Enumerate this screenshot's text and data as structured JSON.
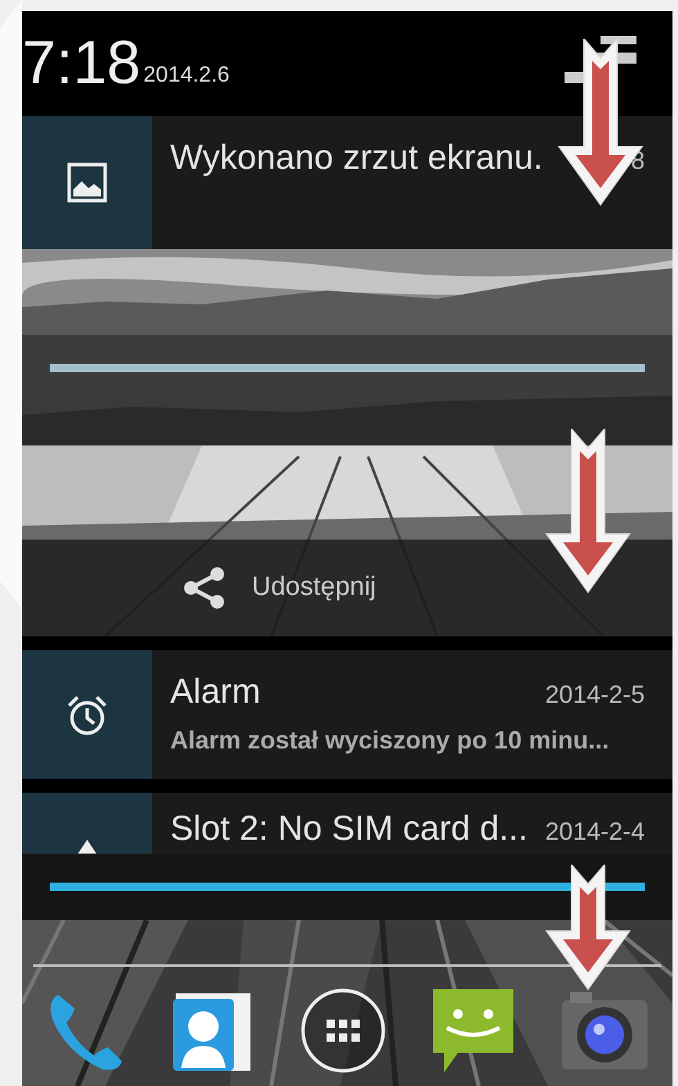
{
  "status_bar": {
    "time": "7:18",
    "date": "2014.2.6"
  },
  "notifications": [
    {
      "kind": "screenshot",
      "title": "Wykonano zrzut ekranu.",
      "time": "8",
      "action": "Udostępnij"
    },
    {
      "kind": "alarm",
      "title": "Alarm",
      "time": "2014-2-5",
      "text": "Alarm został wyciszony po 10 minu..."
    },
    {
      "kind": "sim",
      "title": "Slot 2: No SIM card d...",
      "time": "2014-2-4"
    }
  ]
}
